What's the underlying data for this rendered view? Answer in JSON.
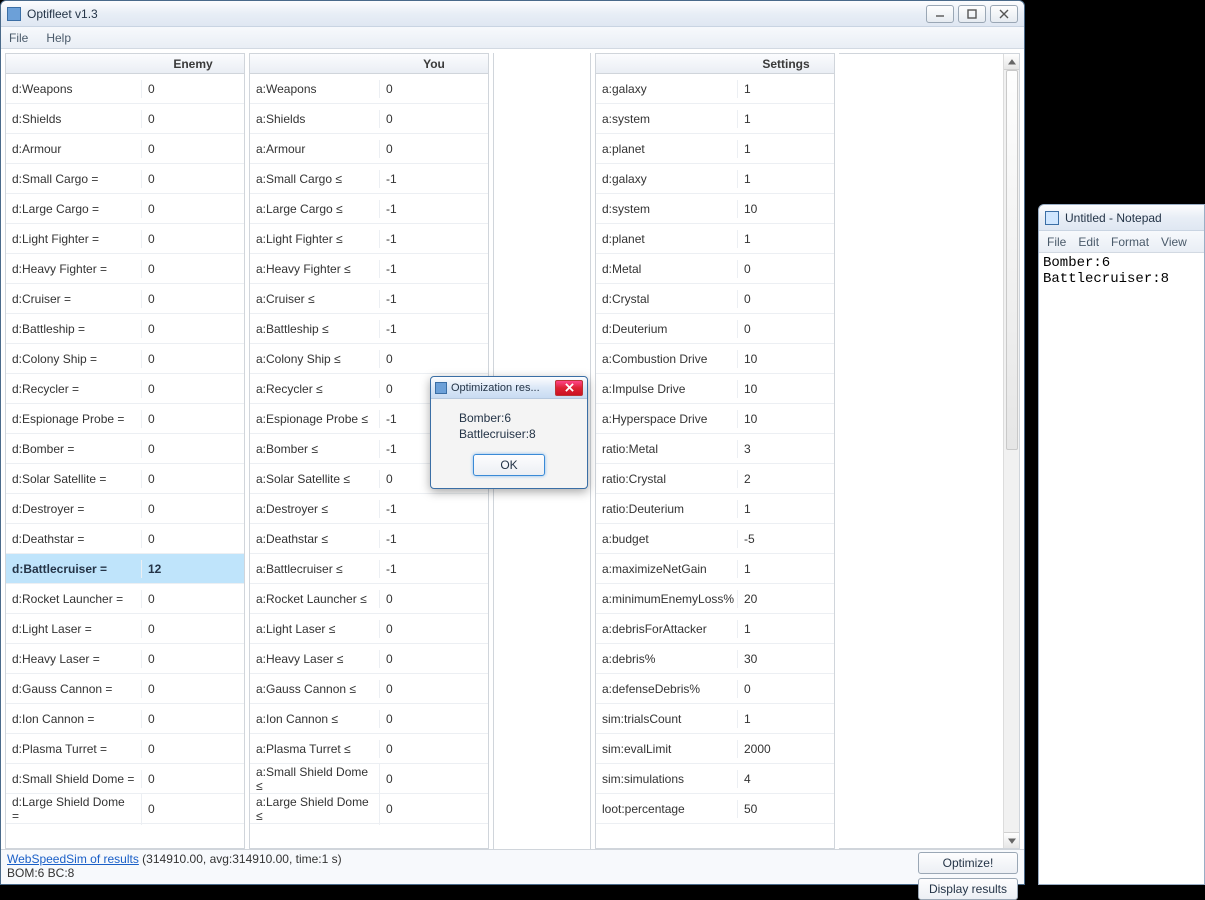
{
  "main": {
    "title": "Optifleet v1.3",
    "menu": {
      "file": "File",
      "help": "Help"
    },
    "headers": {
      "enemy": "Enemy",
      "you": "You",
      "settings": "Settings"
    },
    "enemy": [
      {
        "label": "d:Weapons",
        "value": "0"
      },
      {
        "label": "d:Shields",
        "value": "0"
      },
      {
        "label": "d:Armour",
        "value": "0"
      },
      {
        "label": "d:Small Cargo =",
        "value": "0"
      },
      {
        "label": "d:Large Cargo =",
        "value": "0"
      },
      {
        "label": "d:Light Fighter =",
        "value": "0"
      },
      {
        "label": "d:Heavy Fighter =",
        "value": "0"
      },
      {
        "label": "d:Cruiser =",
        "value": "0"
      },
      {
        "label": "d:Battleship =",
        "value": "0"
      },
      {
        "label": "d:Colony Ship =",
        "value": "0"
      },
      {
        "label": "d:Recycler =",
        "value": "0"
      },
      {
        "label": "d:Espionage Probe =",
        "value": "0"
      },
      {
        "label": "d:Bomber =",
        "value": "0"
      },
      {
        "label": "d:Solar Satellite =",
        "value": "0"
      },
      {
        "label": "d:Destroyer =",
        "value": "0"
      },
      {
        "label": "d:Deathstar =",
        "value": "0"
      },
      {
        "label": "d:Battlecruiser =",
        "value": "12",
        "selected": true
      },
      {
        "label": "d:Rocket Launcher =",
        "value": "0"
      },
      {
        "label": "d:Light Laser =",
        "value": "0"
      },
      {
        "label": "d:Heavy Laser =",
        "value": "0"
      },
      {
        "label": "d:Gauss Cannon =",
        "value": "0"
      },
      {
        "label": "d:Ion Cannon =",
        "value": "0"
      },
      {
        "label": "d:Plasma Turret =",
        "value": "0"
      },
      {
        "label": "d:Small Shield Dome =",
        "value": "0"
      },
      {
        "label": "d:Large Shield Dome =",
        "value": "0"
      }
    ],
    "you": [
      {
        "label": "a:Weapons",
        "value": "0"
      },
      {
        "label": "a:Shields",
        "value": "0"
      },
      {
        "label": "a:Armour",
        "value": "0"
      },
      {
        "label": "a:Small Cargo ≤",
        "value": "-1"
      },
      {
        "label": "a:Large Cargo ≤",
        "value": "-1"
      },
      {
        "label": "a:Light Fighter ≤",
        "value": "-1"
      },
      {
        "label": "a:Heavy Fighter ≤",
        "value": "-1"
      },
      {
        "label": "a:Cruiser ≤",
        "value": "-1"
      },
      {
        "label": "a:Battleship ≤",
        "value": "-1"
      },
      {
        "label": "a:Colony Ship ≤",
        "value": "0"
      },
      {
        "label": "a:Recycler ≤",
        "value": "0"
      },
      {
        "label": "a:Espionage Probe ≤",
        "value": "-1"
      },
      {
        "label": "a:Bomber ≤",
        "value": "-1"
      },
      {
        "label": "a:Solar Satellite ≤",
        "value": "0"
      },
      {
        "label": "a:Destroyer ≤",
        "value": "-1"
      },
      {
        "label": "a:Deathstar ≤",
        "value": "-1"
      },
      {
        "label": "a:Battlecruiser ≤",
        "value": "-1"
      },
      {
        "label": "a:Rocket Launcher ≤",
        "value": "0"
      },
      {
        "label": "a:Light Laser ≤",
        "value": "0"
      },
      {
        "label": "a:Heavy Laser ≤",
        "value": "0"
      },
      {
        "label": "a:Gauss Cannon ≤",
        "value": "0"
      },
      {
        "label": "a:Ion Cannon ≤",
        "value": "0"
      },
      {
        "label": "a:Plasma Turret ≤",
        "value": "0"
      },
      {
        "label": "a:Small Shield Dome ≤",
        "value": "0"
      },
      {
        "label": "a:Large Shield Dome ≤",
        "value": "0"
      }
    ],
    "settings": [
      {
        "label": "a:galaxy",
        "value": "1"
      },
      {
        "label": "a:system",
        "value": "1"
      },
      {
        "label": "a:planet",
        "value": "1"
      },
      {
        "label": "d:galaxy",
        "value": "1"
      },
      {
        "label": "d:system",
        "value": "10"
      },
      {
        "label": "d:planet",
        "value": "1"
      },
      {
        "label": "d:Metal",
        "value": "0"
      },
      {
        "label": "d:Crystal",
        "value": "0"
      },
      {
        "label": "d:Deuterium",
        "value": "0"
      },
      {
        "label": "a:Combustion Drive",
        "value": "10"
      },
      {
        "label": "a:Impulse Drive",
        "value": "10"
      },
      {
        "label": "a:Hyperspace Drive",
        "value": "10"
      },
      {
        "label": "ratio:Metal",
        "value": "3"
      },
      {
        "label": "ratio:Crystal",
        "value": "2"
      },
      {
        "label": "ratio:Deuterium",
        "value": "1"
      },
      {
        "label": "a:budget",
        "value": "-5"
      },
      {
        "label": "a:maximizeNetGain",
        "value": "1"
      },
      {
        "label": "a:minimumEnemyLoss%",
        "value": "20"
      },
      {
        "label": "a:debrisForAttacker",
        "value": "1"
      },
      {
        "label": "a:debris%",
        "value": "30"
      },
      {
        "label": "a:defenseDebris%",
        "value": "0"
      },
      {
        "label": "sim:trialsCount",
        "value": "1"
      },
      {
        "label": "sim:evalLimit",
        "value": "2000"
      },
      {
        "label": "sim:simulations",
        "value": "4"
      },
      {
        "label": "loot:percentage",
        "value": "50"
      }
    ],
    "status": {
      "link": "WebSpeedSim of results",
      "linkExtra": " (314910.00, avg:314910.00, time:1 s)",
      "line2": "BOM:6 BC:8",
      "optimize": "Optimize!",
      "display": "Display results"
    }
  },
  "dialog": {
    "title": "Optimization res...",
    "line1": "Bomber:6",
    "line2": "Battlecruiser:8",
    "ok": "OK"
  },
  "notepad": {
    "title": "Untitled - Notepad",
    "menu": {
      "file": "File",
      "edit": "Edit",
      "format": "Format",
      "view": "View"
    },
    "content": "Bomber:6\nBattlecruiser:8"
  }
}
